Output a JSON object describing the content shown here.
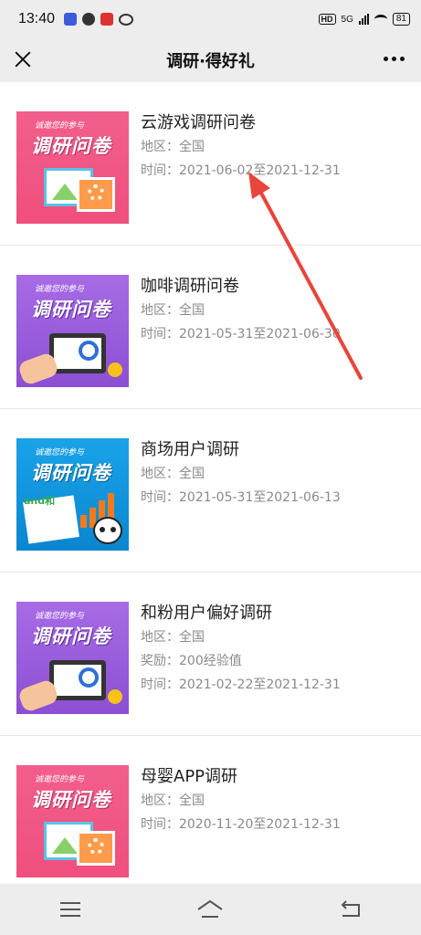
{
  "status_bar": {
    "time": "13:40",
    "network": "5G",
    "battery": "81"
  },
  "nav": {
    "title": "调研·得好礼"
  },
  "surveys": [
    {
      "title": "云游戏调研问卷",
      "region": "地区：全国",
      "time": "时间：2021-06-02至2021-12-31",
      "thumb_sub": "诚邀您的参与",
      "thumb_main": "调研问卷",
      "theme": "pink"
    },
    {
      "title": "咖啡调研问卷",
      "region": "地区：全国",
      "time": "时间：2021-05-31至2021-06-30",
      "thumb_sub": "诚邀您的参与",
      "thumb_main": "调研问卷",
      "theme": "purple"
    },
    {
      "title": "商场用户调研",
      "region": "地区：全国",
      "time": "时间：2021-05-31至2021-06-13",
      "thumb_sub": "诚邀您的参与",
      "thumb_main": "调研问卷",
      "thumb_logo": "and和",
      "theme": "blue"
    },
    {
      "title": "和粉用户偏好调研",
      "region": "地区：全国",
      "reward": "奖励：200经验值",
      "time": "时间：2021-02-22至2021-12-31",
      "thumb_sub": "诚邀您的参与",
      "thumb_main": "调研问卷",
      "theme": "purple"
    },
    {
      "title": "母婴APP调研",
      "region": "地区：全国",
      "time": "时间：2020-11-20至2021-12-31",
      "thumb_sub": "诚邀您的参与",
      "thumb_main": "调研问卷",
      "theme": "pink"
    }
  ],
  "colors": {
    "nav_bg": "#ededed",
    "annotation_arrow": "#e8453c",
    "meta_text": "#8a8a8a"
  }
}
